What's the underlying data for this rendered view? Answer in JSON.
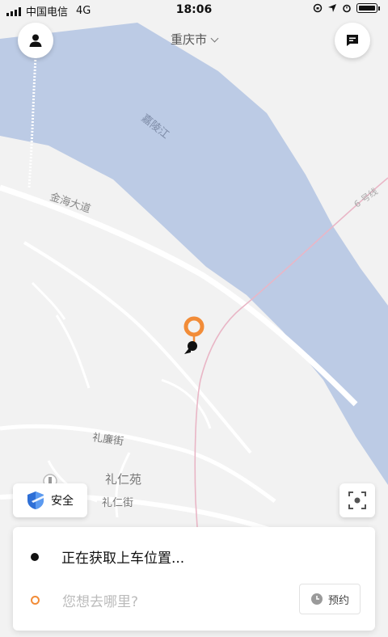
{
  "status_bar": {
    "carrier": "中国电信",
    "network": "4G",
    "time": "18:06"
  },
  "header": {
    "city": "重庆市"
  },
  "map": {
    "labels": {
      "river": "嘉陵江",
      "road_main": "金海大道",
      "metro_line": "6 号线",
      "street_1": "礼廉街",
      "area_1": "礼仁苑",
      "street_2": "礼仁街"
    },
    "colors": {
      "water": "#bccbe5",
      "land": "#f2f2f2",
      "road": "#ffffff",
      "metro": "#e9b6c6",
      "accent": "#f28c38"
    }
  },
  "controls": {
    "safety_label": "安全"
  },
  "trip_panel": {
    "pickup_text": "正在获取上车位置...",
    "destination_placeholder": "您想去哪里?",
    "reserve_label": "预约"
  },
  "icons": {
    "avatar": "person-icon",
    "messages": "chat-icon",
    "safety": "shield-icon",
    "locate": "locate-icon",
    "pin": "pickup-pin-icon",
    "reserve": "clock-icon"
  }
}
